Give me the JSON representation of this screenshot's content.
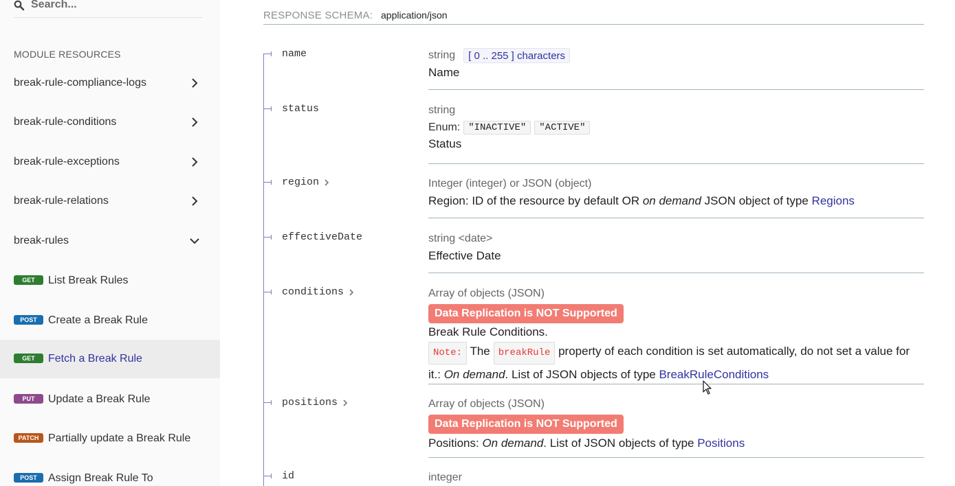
{
  "sidebar": {
    "search_placeholder": "Search...",
    "section_title": "MODULE RESOURCES",
    "groups": [
      {
        "label": "break-rule-compliance-logs",
        "expanded": false
      },
      {
        "label": "break-rule-conditions",
        "expanded": false
      },
      {
        "label": "break-rule-exceptions",
        "expanded": false
      },
      {
        "label": "break-rule-relations",
        "expanded": false
      },
      {
        "label": "break-rules",
        "expanded": true
      }
    ],
    "operations": [
      {
        "method": "GET",
        "label": "List Break Rules",
        "color": "#2e7d32",
        "active": false
      },
      {
        "method": "POST",
        "label": "Create a Break Rule",
        "color": "#1a6eb0",
        "active": false
      },
      {
        "method": "GET",
        "label": "Fetch a Break Rule",
        "color": "#2e7d32",
        "active": true
      },
      {
        "method": "PUT",
        "label": "Update a Break Rule",
        "color": "#8e4a8d",
        "active": false
      },
      {
        "method": "PATCH",
        "label": "Partially update a Break Rule",
        "color": "#b8561c",
        "active": false
      },
      {
        "method": "POST",
        "label": "Assign Break Rule To",
        "color": "#1a6eb0",
        "active": false
      }
    ]
  },
  "schema": {
    "label": "RESPONSE SCHEMA:",
    "content_type": "application/json"
  },
  "properties": {
    "name": {
      "name": "name",
      "type": "string",
      "constraint": "[ 0 .. 255 ] characters",
      "description": "Name"
    },
    "status": {
      "name": "status",
      "type": "string",
      "enum_label": "Enum:",
      "enum_values": [
        "\"INACTIVE\"",
        "\"ACTIVE\""
      ],
      "description": "Status"
    },
    "region": {
      "name": "region",
      "type": "Integer (integer) or JSON (object)",
      "desc_prefix": "Region: ID of the resource by default OR ",
      "desc_em": "on demand",
      "desc_middle": " JSON object of type ",
      "desc_link": "Regions"
    },
    "effectiveDate": {
      "name": "effectiveDate",
      "type": "string <date>",
      "description": "Effective Date"
    },
    "conditions": {
      "name": "conditions",
      "type": "Array of objects (JSON)",
      "warning": "Data Replication is NOT Supported",
      "desc_line1": "Break Rule Conditions.",
      "note_label": "Note:",
      "note_the": "The",
      "note_code": "breakRule",
      "note_text": "property of each condition is set automatically, do not set a value for it.:",
      "desc_em": "On demand",
      "desc_middle": ". List of JSON objects of type ",
      "desc_link": "BreakRuleConditions"
    },
    "positions": {
      "name": "positions",
      "type": "Array of objects (JSON)",
      "warning": "Data Replication is NOT Supported",
      "desc_prefix": "Positions: ",
      "desc_em": "On demand",
      "desc_middle": ". List of JSON objects of type ",
      "desc_link": "Positions"
    },
    "id": {
      "name": "id",
      "type": "integer"
    }
  },
  "icons": {
    "search": "search-icon",
    "chevron_right": "chevron-right-icon",
    "chevron_down": "chevron-down-icon",
    "expand": "expand-chevron-icon",
    "cursor": "mouse-cursor-icon"
  },
  "colors": {
    "link": "#32329f",
    "warning_bg": "#f27c73",
    "tree_line": "#7c7cbb",
    "sidebar_bg": "#fafafa",
    "active_item_bg": "#ececec"
  }
}
